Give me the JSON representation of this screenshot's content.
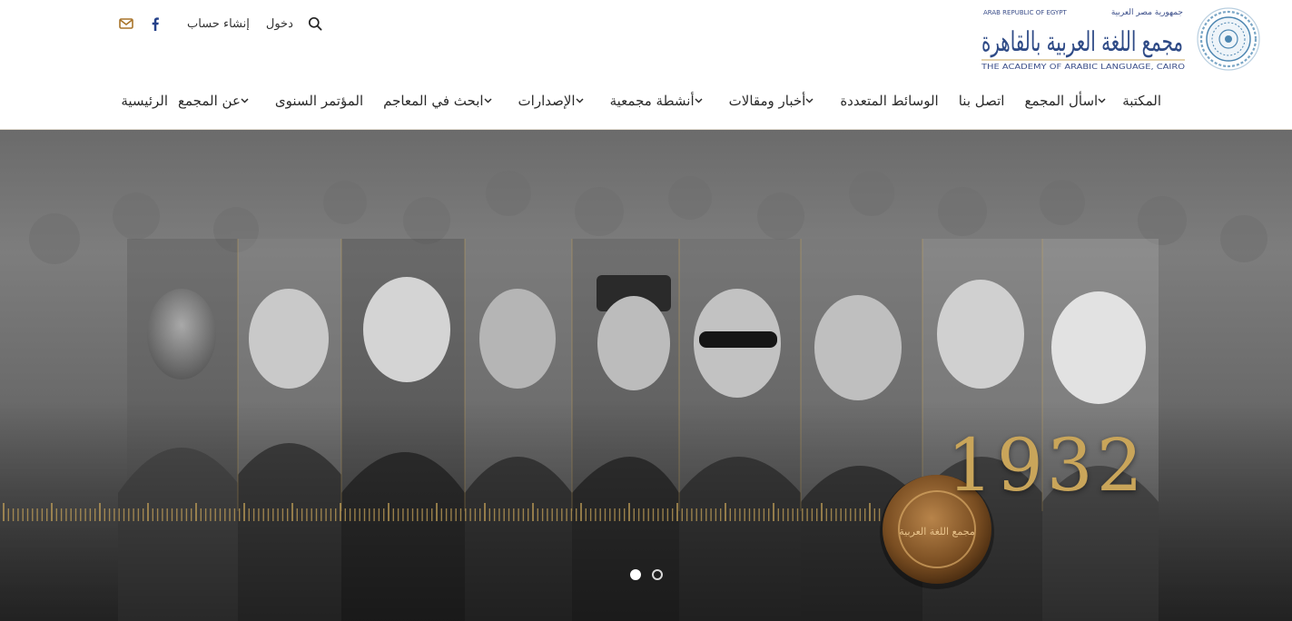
{
  "colors": {
    "accent_gold": "#c9a55a",
    "mail_icon": "#a8742a",
    "facebook_icon": "#25418a",
    "nav_text": "#2a2a2a"
  },
  "topbar": {
    "register_label": "إنشاء حساب",
    "login_label": "دخول",
    "icons": [
      "search-icon",
      "mail-icon",
      "facebook-icon"
    ]
  },
  "logo": {
    "country_ar": "جمهورية مصر العربية",
    "country_en": "ARAB REPUBLIC OF EGYPT",
    "name_ar": "مجمع اللغة العربية بالقاهرة",
    "name_en": "THE ACADEMY OF ARABIC LANGUAGE, CAIRO"
  },
  "nav": {
    "items": [
      {
        "label": "الرئيسية",
        "dropdown": false
      },
      {
        "label": "عن المجمع",
        "dropdown": true
      },
      {
        "label": "المؤتمر السنوى",
        "dropdown": false
      },
      {
        "label": "ابحث في المعاجم",
        "dropdown": true
      },
      {
        "label": "الإصدارات",
        "dropdown": true
      },
      {
        "label": "أنشطة مجمعية",
        "dropdown": true
      },
      {
        "label": "أخبار ومقالات",
        "dropdown": true
      },
      {
        "label": "الوسائط المتعددة",
        "dropdown": false
      },
      {
        "label": "اتصل بنا",
        "dropdown": false
      },
      {
        "label": "اسأل المجمع",
        "dropdown": true
      },
      {
        "label": "المكتبة",
        "dropdown": false
      }
    ]
  },
  "hero": {
    "year": "1932",
    "seal_text": "مجمع اللغة العربية",
    "slides": [
      {
        "active": true
      },
      {
        "active": false
      }
    ]
  }
}
